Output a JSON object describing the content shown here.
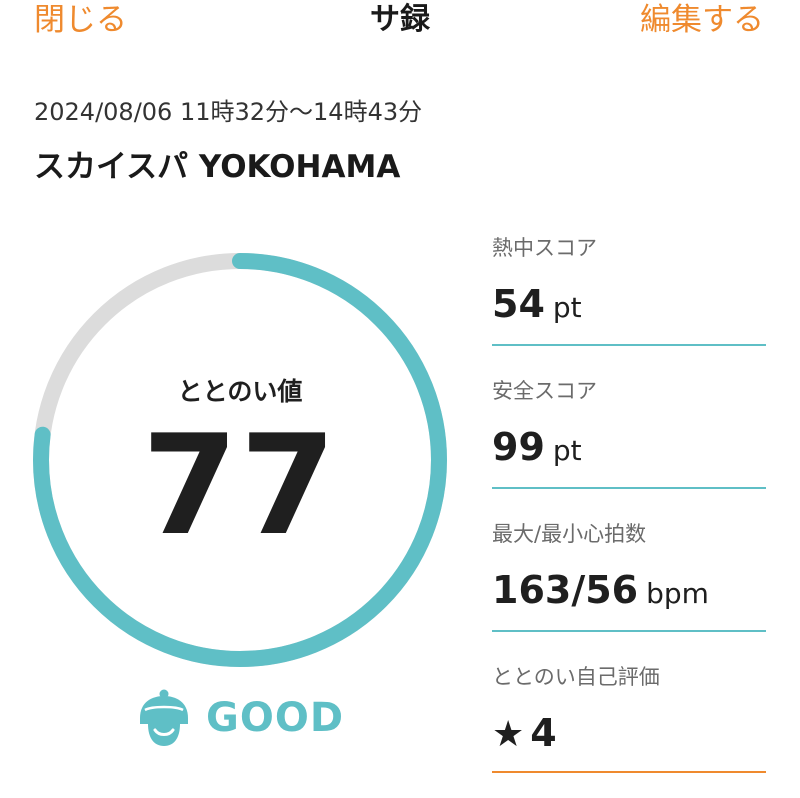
{
  "header": {
    "close_label": "閉じる",
    "title": "サ録",
    "edit_label": "編集する"
  },
  "session": {
    "datetime": "2024/08/06 11時32分〜14時43分",
    "facility": "スカイスパ YOKOHAMA"
  },
  "totonoi": {
    "label": "ととのい値",
    "value": "77",
    "progress_percent": 77,
    "rating_label": "GOOD",
    "rating_icon": "hooded-face-icon"
  },
  "stats": {
    "heat": {
      "label": "熱中スコア",
      "value": "54",
      "unit": "pt"
    },
    "safety": {
      "label": "安全スコア",
      "value": "99",
      "unit": "pt"
    },
    "heart_rate": {
      "label": "最大/最小心拍数",
      "value": "163/56",
      "unit": "bpm"
    },
    "self_rating": {
      "label": "ととのい自己評価",
      "star": "★",
      "value": "4"
    }
  },
  "colors": {
    "accent_orange": "#ef8a2e",
    "accent_teal": "#5fbfc6",
    "ring_track": "#dcdcdc"
  }
}
